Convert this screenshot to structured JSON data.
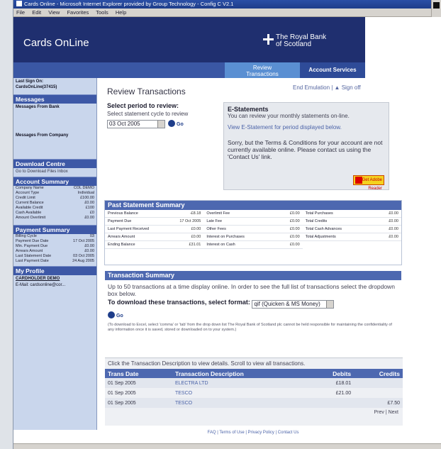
{
  "browser": {
    "title": "Cards Online - Microsoft Internet Explorer provided by Group Technology - Config C V2.1",
    "menu": [
      "File",
      "Edit",
      "View",
      "Favorites",
      "Tools",
      "Help"
    ]
  },
  "header": {
    "app_title": "Cards OnLine",
    "logo_line1": "The Royal Bank",
    "logo_line2": "of Scotland",
    "tab_review_line1": "Review",
    "tab_review_line2": "Transactions",
    "tab_services": "Account Services"
  },
  "sidebar": {
    "last_sign_on_label": "Last Sign On:",
    "last_sign_on_value": "CardsOnLine(37415)",
    "messages_heading": "Messages",
    "messages_bank": "Messages From Bank",
    "messages_company": "Messages From Company",
    "download_heading": "Download Centre",
    "download_link": "Go to Download Files Inbox",
    "account_heading": "Account Summary",
    "account_rows": [
      {
        "k": "Company Name",
        "v": "COL DEMO"
      },
      {
        "k": "Account Type",
        "v": "Individual"
      },
      {
        "k": "Credit Limit",
        "v": "£100.00"
      },
      {
        "k": "Current Balance",
        "v": "£0.00"
      },
      {
        "k": "Available Credit",
        "v": "£100"
      },
      {
        "k": "Cash Available",
        "v": "£0"
      },
      {
        "k": "Amount Overlimit",
        "v": "£0.00"
      }
    ],
    "payment_heading": "Payment Summary",
    "payment_rows": [
      {
        "k": "Billing Cycle",
        "v": "03"
      },
      {
        "k": "Payment Due Date",
        "v": "17 Oct 2005"
      },
      {
        "k": "Min. Payment Due",
        "v": "£0.00"
      },
      {
        "k": "Arrears Amount",
        "v": "£0.00"
      },
      {
        "k": "Last Statement Date",
        "v": "03 Oct 2005"
      },
      {
        "k": "Last Payment Date",
        "v": "24 Aug 2005"
      }
    ],
    "profile_heading": "My Profile",
    "profile_name": "CARDHOLDER DEMO",
    "profile_email": "E-Mail: cardsonline@cor..."
  },
  "main": {
    "page_title": "Review Transactions",
    "top_links": "End Emulation | ▲ Sign off",
    "select_heading": "Select period to review:",
    "select_sub": "Select statement cycle to review",
    "period_value": "03 Oct 2005",
    "go_label": "Go",
    "estatements": {
      "heading": "E-Statements",
      "text": "You can review your monthly statements on-line.",
      "link": "View E-Statement for period displayed below.",
      "note": "Sorry, but the Terms & Conditions for your account are not currently available online. Please contact us using the 'Contact Us' link.",
      "adobe_label": "Get Adobe Reader"
    },
    "summary": {
      "heading": "Past Statement Summary",
      "col1": [
        {
          "k": "Previous Balance",
          "v": "-£8.18"
        },
        {
          "k": "Payment Due",
          "v": "17 Oct 2005"
        },
        {
          "k": "Last Payment Received",
          "v": "£0.00"
        },
        {
          "k": "Arrears Amount",
          "v": "£0.00"
        },
        {
          "k": "Ending Balance",
          "v": "£31.01"
        }
      ],
      "col2": [
        {
          "k": "Overlimit Fee",
          "v": "£0.00"
        },
        {
          "k": "Late Fee",
          "v": "£0.00"
        },
        {
          "k": "Other Fees",
          "v": "£0.00"
        },
        {
          "k": "Interest on Purchases",
          "v": "£0.00"
        },
        {
          "k": "Interest on Cash",
          "v": "£0.00"
        }
      ],
      "col3": [
        {
          "k": "Total Purchases",
          "v": "£0.00"
        },
        {
          "k": "Total Credits",
          "v": "£0.00"
        },
        {
          "k": "Total Cash Advances",
          "v": "£0.00"
        },
        {
          "k": "Total Adjustments",
          "v": "£0.00"
        }
      ]
    },
    "transactions": {
      "heading": "Transaction Summary",
      "intro": "Up to 50 transactions at a time display online. In order to see the full list of transactions select the dropdown box below.",
      "download_label": "To download these transactions, select format:",
      "format_value": "qif (Quicken & MS Money)",
      "go_label": "Go",
      "disclaimer": "(To download to Excel, select 'comma' or 'tab' from the drop down list The Royal Bank of Scotland plc cannot be held responsible for maintaining the confidentiality of any information once it is saved, stored or downloaded on to your system.)",
      "hint": "Click the Transaction Description to view details. Scroll to view all transactions.",
      "columns": [
        "Trans Date",
        "Transaction Description",
        "Debits",
        "Credits"
      ],
      "rows": [
        {
          "date": "01 Sep 2005",
          "desc": "ELECTRA LTD",
          "debit": "£18.01",
          "credit": ""
        },
        {
          "date": "01 Sep 2005",
          "desc": "TESCO",
          "debit": "£21.00",
          "credit": ""
        },
        {
          "date": "01 Sep 2005",
          "desc": "TESCO",
          "debit": "",
          "credit": "£7.50"
        }
      ],
      "pager": "Prev | Next"
    },
    "footer": "FAQ | Terms of Use | Privacy Policy | Contact Us"
  }
}
